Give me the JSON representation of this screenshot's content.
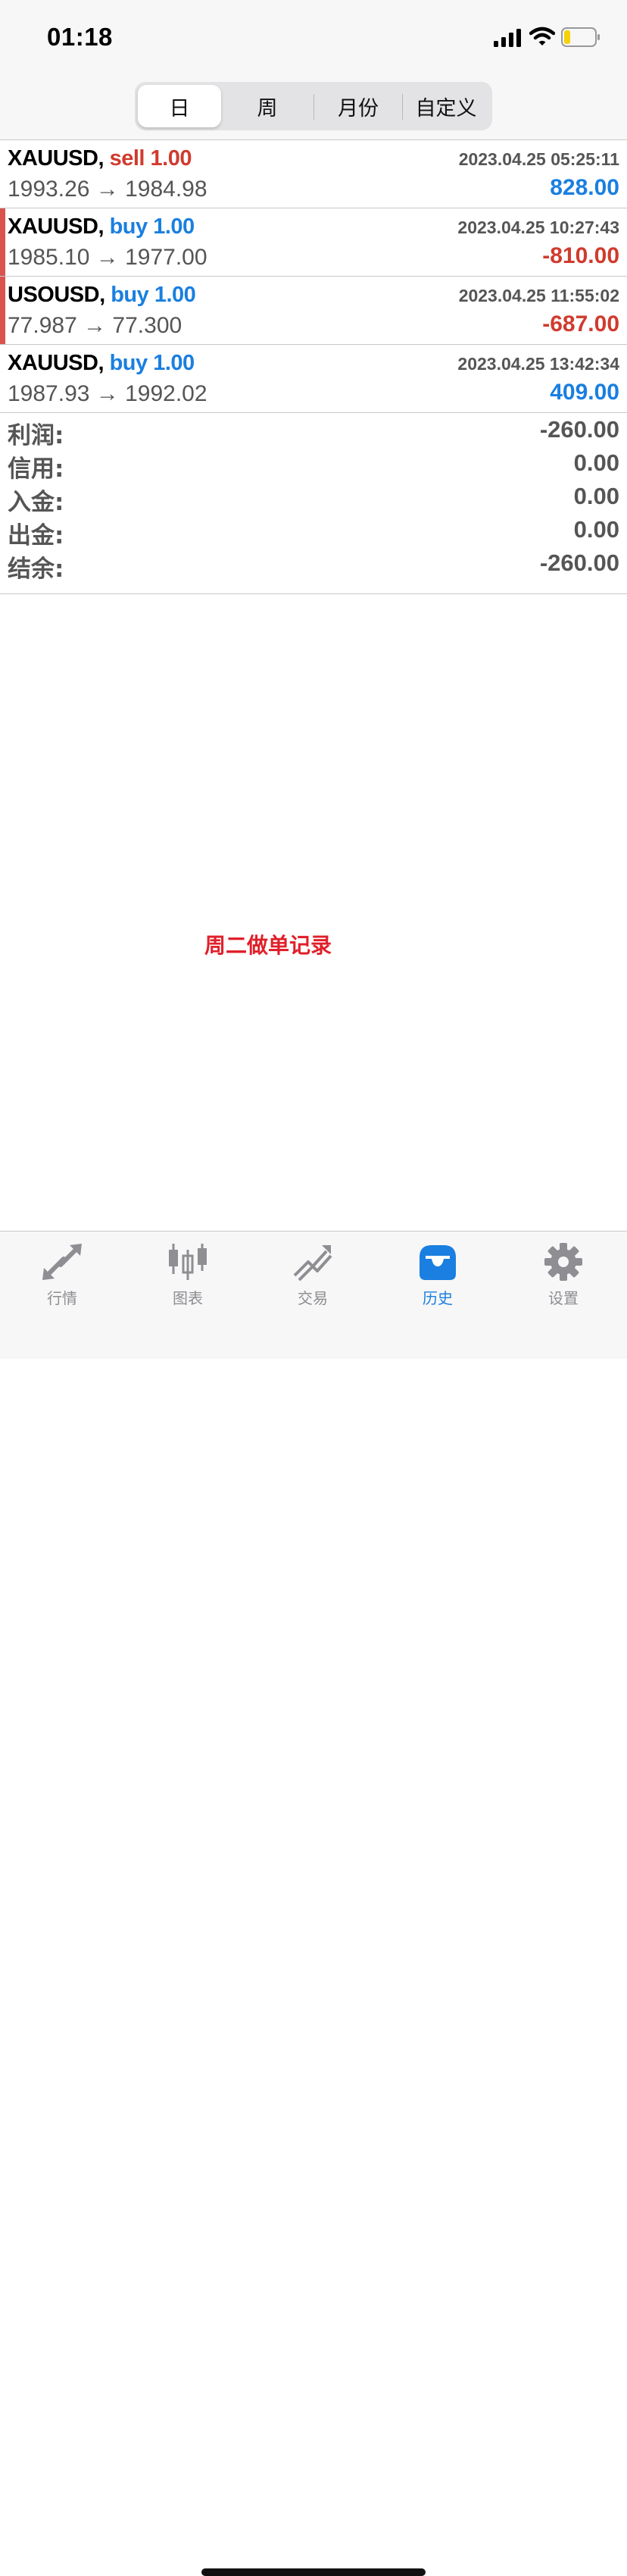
{
  "status_bar": {
    "time": "01:18"
  },
  "segments": [
    {
      "label": "日",
      "active": true
    },
    {
      "label": "周",
      "active": false
    },
    {
      "label": "月份",
      "active": false
    },
    {
      "label": "自定义",
      "active": false
    }
  ],
  "deals": [
    {
      "symbol": "XAUUSD,",
      "side": "sell",
      "volume": "sell 1.00",
      "time": "2023.04.25 05:25:11",
      "prices": "1993.26 → 1984.98",
      "profit": "828.00"
    },
    {
      "symbol": "XAUUSD,",
      "side": "buy",
      "volume": "buy 1.00",
      "time": "2023.04.25 10:27:43",
      "prices": "1985.10 → 1977.00",
      "profit": "-810.00"
    },
    {
      "symbol": "USOUSD,",
      "side": "buy",
      "volume": "buy 1.00",
      "time": "2023.04.25 11:55:02",
      "prices": "77.987 → 77.300",
      "profit": "-687.00"
    },
    {
      "symbol": "XAUUSD,",
      "side": "buy",
      "volume": "buy 1.00",
      "time": "2023.04.25 13:42:34",
      "prices": "1987.93 → 1992.02",
      "profit": "409.00"
    }
  ],
  "summary": [
    {
      "label": "利润:",
      "value": "-260.00"
    },
    {
      "label": "信用:",
      "value": "0.00"
    },
    {
      "label": "入金:",
      "value": "0.00"
    },
    {
      "label": "出金:",
      "value": "0.00"
    },
    {
      "label": "结余:",
      "value": "-260.00"
    }
  ],
  "annotation": "周二做单记录",
  "tabs": [
    {
      "label": "行情",
      "icon": "quotes-arrows-icon",
      "active": false
    },
    {
      "label": "图表",
      "icon": "candlestick-chart-icon",
      "active": false
    },
    {
      "label": "交易",
      "icon": "trade-trend-icon",
      "active": false
    },
    {
      "label": "历史",
      "icon": "history-inbox-icon",
      "active": true
    },
    {
      "label": "设置",
      "icon": "gear-icon",
      "active": false
    }
  ],
  "colors": {
    "buy": "#1a7fe0",
    "sell": "#d03b2e",
    "active_tab": "#1a7fe0",
    "inactive_tab": "#8e8e93",
    "annotation": "#e0202a"
  }
}
